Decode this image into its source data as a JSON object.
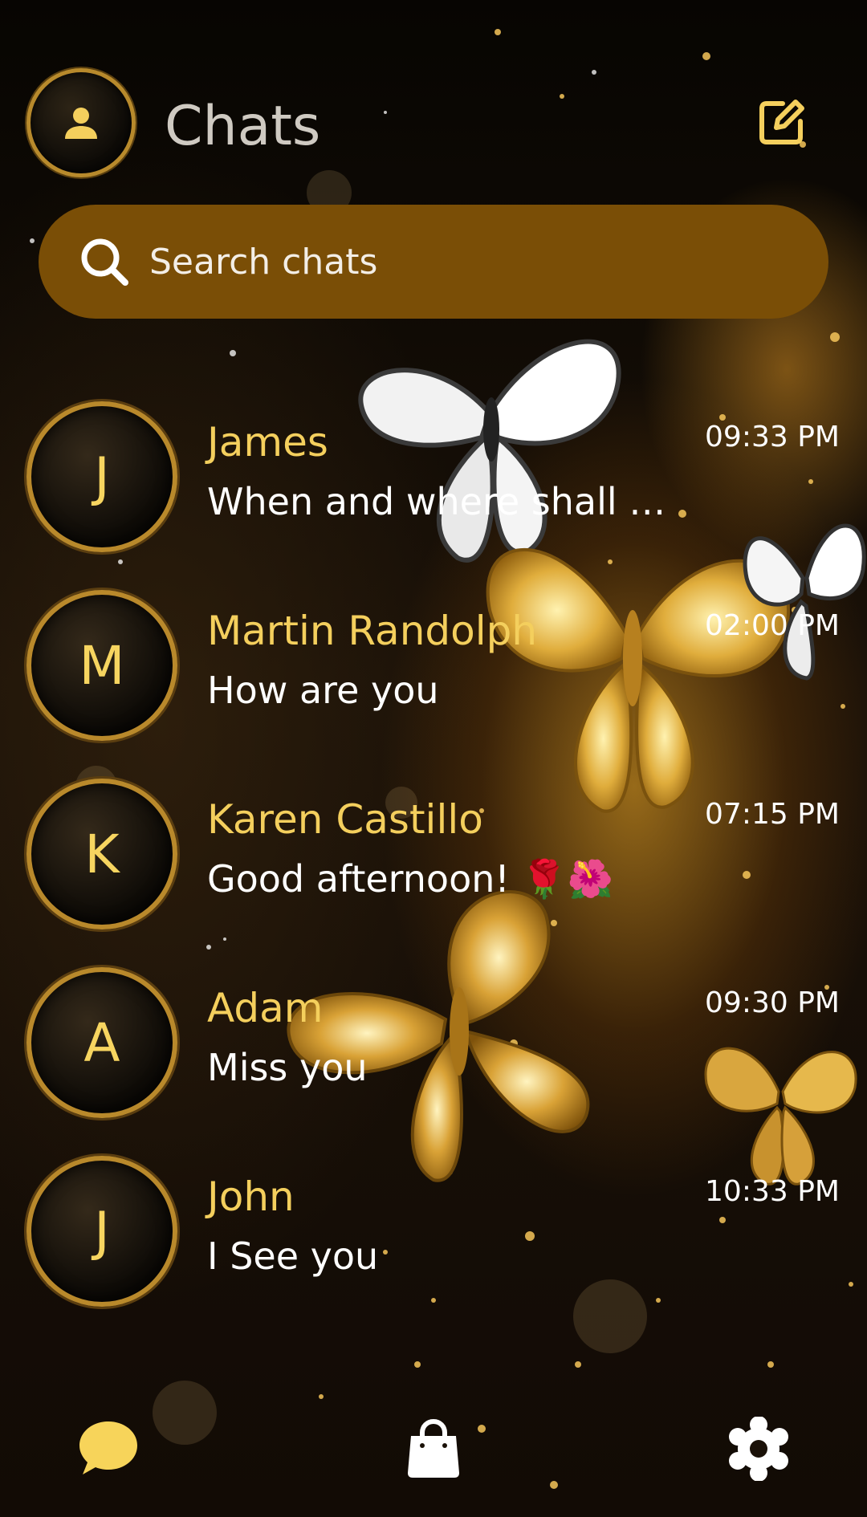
{
  "header": {
    "title": "Chats",
    "profile_icon": "person-icon",
    "compose_icon": "compose-icon"
  },
  "search": {
    "placeholder": "Search chats",
    "icon": "search-icon"
  },
  "chats": [
    {
      "initial": "J",
      "name": "James",
      "message": "When and where shall we...",
      "time": "09:33 PM"
    },
    {
      "initial": "M",
      "name": "Martin Randolph",
      "message": "How are you",
      "time": "02:00 PM"
    },
    {
      "initial": "K",
      "name": "Karen Castillo",
      "message": "Good afternoon! 🌹🌺",
      "time": "07:15 PM"
    },
    {
      "initial": "A",
      "name": "Adam",
      "message": "Miss you",
      "time": "09:30 PM"
    },
    {
      "initial": "J",
      "name": "John",
      "message": "I See you",
      "time": "10:33 PM"
    }
  ],
  "bottom_nav": {
    "items": [
      "chat-bubble-icon",
      "shopping-bag-icon",
      "settings-gear-icon"
    ]
  },
  "colors": {
    "accent_gold": "#f4cf5d",
    "search_bg": "#7a4e06",
    "avatar_ring": "#b9892b"
  }
}
